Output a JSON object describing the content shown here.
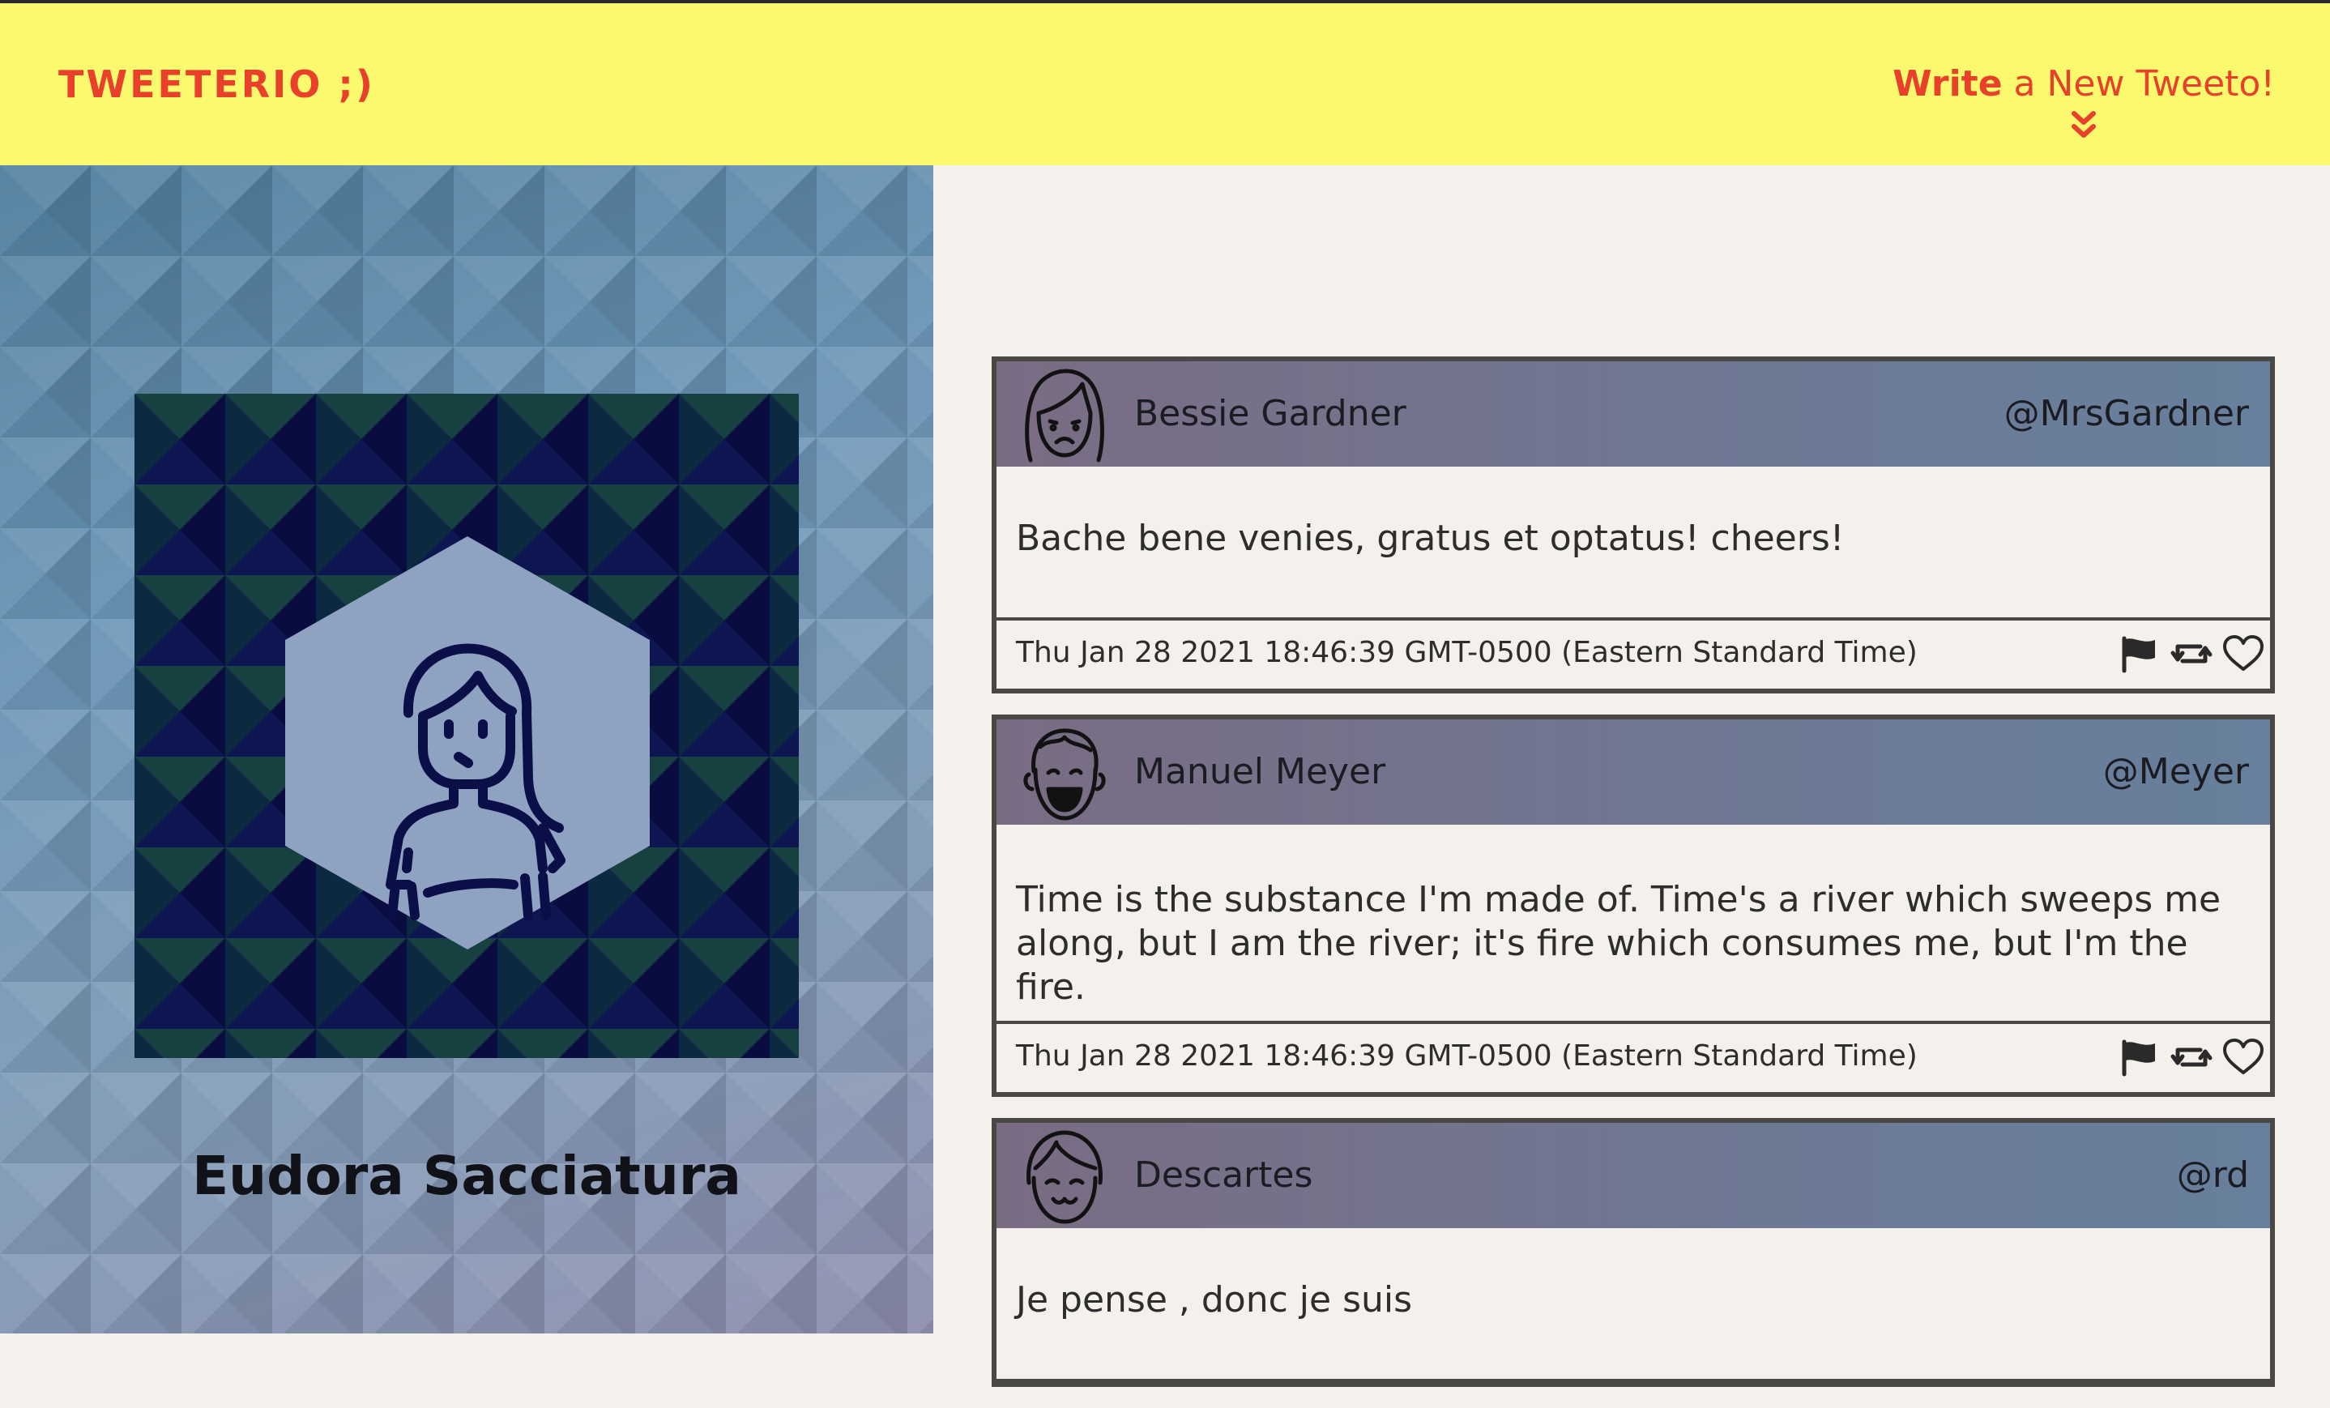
{
  "nav": {
    "brand": "TWEETERIO ;)",
    "compose_strong": "Write",
    "compose_rest": " a New Tweeto!",
    "compose_icon": "double-chevron-down-icon",
    "accent_color": "#e9402b",
    "background_color": "#fbfa6e"
  },
  "profile": {
    "name": "Eudora Sacciatura",
    "avatar_icon": "woman-avatar-icon"
  },
  "tweets": [
    {
      "author": "Bessie Gardner",
      "handle": "@MrsGardner",
      "text": "Bache bene venies, gratus et optatus! cheers!",
      "date": "Thu Jan 28 2021 18:46:39 GMT-0500 (Eastern Standard Time)",
      "avatar_icon": "sad-woman-avatar-icon"
    },
    {
      "author": "Manuel Meyer",
      "handle": "@Meyer",
      "text": "Time is the substance I'm made of. Time's a river which sweeps me along, but I am the river; it's fire which consumes me, but I'm the fire.",
      "date": "Thu Jan 28 2021 18:46:39 GMT-0500 (Eastern Standard Time)",
      "avatar_icon": "laughing-man-avatar-icon"
    },
    {
      "author": "Descartes",
      "handle": "@rd",
      "text": "Je pense , donc je suis",
      "date": "",
      "avatar_icon": "smiling-woman-avatar-icon"
    }
  ],
  "actions": {
    "flag_icon": "flag-icon",
    "retweet_icon": "retweet-icon",
    "like_icon": "heart-icon"
  }
}
